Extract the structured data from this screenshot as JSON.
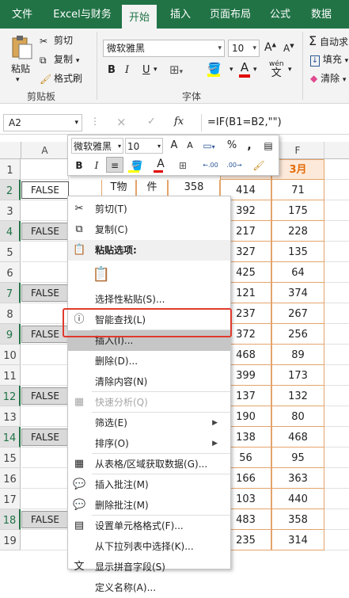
{
  "tabs": [
    "文件",
    "Excel与财务",
    "开始",
    "插入",
    "页面布局",
    "公式",
    "数据"
  ],
  "active_tab": "开始",
  "ribbon": {
    "paste_label": "粘贴",
    "cut_label": "剪切",
    "copy_label": "复制",
    "format_painter_label": "格式刷",
    "clipboard_group": "剪贴板",
    "font_name": "微软雅黑",
    "font_size": "10",
    "font_group": "字体",
    "autosum_label": "自动求",
    "fill_label": "填充",
    "clear_label": "清除",
    "bold": "B",
    "italic": "I",
    "underline": "U",
    "phonetic": "wén",
    "grow_font": "A",
    "shrink_font": "A"
  },
  "formula_bar": {
    "name_box": "A2",
    "cancel": "×",
    "enter": "✓",
    "fx": "fx",
    "formula": "=IF(B1=B2,\"\")"
  },
  "columns": [
    "A",
    "F"
  ],
  "rows": [
    "1",
    "2",
    "3",
    "4",
    "5",
    "6",
    "7",
    "8",
    "9",
    "10",
    "11",
    "12",
    "13",
    "14",
    "15",
    "16",
    "17",
    "18",
    "19"
  ],
  "col_a_values": {
    "2": "FALSE",
    "4": "FALSE",
    "7": "FALSE",
    "9": "FALSE",
    "12": "FALSE",
    "14": "FALSE",
    "18": "FALSE"
  },
  "header_f": "3月",
  "col_e": [
    "414",
    "392",
    "217",
    "327",
    "425",
    "121",
    "237",
    "372",
    "468",
    "399",
    "137",
    "190",
    "138",
    "56",
    "166",
    "103",
    "483",
    "235"
  ],
  "col_f": [
    "71",
    "175",
    "228",
    "135",
    "64",
    "374",
    "267",
    "256",
    "89",
    "173",
    "132",
    "80",
    "468",
    "95",
    "363",
    "440",
    "358",
    "314"
  ],
  "partial_cells": {
    "b2": "T物",
    "c2": "件",
    "d2": "358"
  },
  "mini_toolbar": {
    "font_name": "微软雅黑",
    "font_size": "10",
    "grow": "A",
    "shrink": "A",
    "percent": "%",
    "comma": ",",
    "bold": "B",
    "italic": "I",
    "dec_inc": ".00",
    "dec_dec": ".00"
  },
  "menu": [
    {
      "label": "剪切(T)",
      "icon": "scissors-icon",
      "glyph": "✂",
      "state": "normal"
    },
    {
      "label": "复制(C)",
      "icon": "copy-icon",
      "glyph": "⧉",
      "state": "normal"
    },
    {
      "label": "粘贴选项:",
      "icon": "clipboard-icon",
      "glyph": "📋",
      "state": "header"
    },
    {
      "label": "",
      "icon": "paste-option-icon",
      "glyph": "📋",
      "state": "paste-option"
    },
    {
      "label": "选择性粘贴(S)...",
      "icon": "",
      "glyph": "",
      "state": "normal"
    },
    {
      "label": "智能查找(L)",
      "icon": "info-icon",
      "glyph": "ⓘ",
      "state": "normal"
    },
    {
      "label": "插入(I)...",
      "icon": "",
      "glyph": "",
      "state": "highlighted"
    },
    {
      "label": "删除(D)...",
      "icon": "",
      "glyph": "",
      "state": "normal"
    },
    {
      "label": "清除内容(N)",
      "icon": "",
      "glyph": "",
      "state": "normal"
    },
    {
      "label": "快速分析(Q)",
      "icon": "quick-analysis-icon",
      "glyph": "▦",
      "state": "disabled"
    },
    {
      "label": "筛选(E)",
      "icon": "",
      "glyph": "",
      "state": "submenu"
    },
    {
      "label": "排序(O)",
      "icon": "",
      "glyph": "",
      "state": "submenu"
    },
    {
      "label": "从表格/区域获取数据(G)...",
      "icon": "table-icon",
      "glyph": "▦",
      "state": "normal"
    },
    {
      "label": "插入批注(M)",
      "icon": "insert-comment-icon",
      "glyph": "💬",
      "state": "normal"
    },
    {
      "label": "删除批注(M)",
      "icon": "delete-comment-icon",
      "glyph": "💬",
      "state": "normal"
    },
    {
      "label": "设置单元格格式(F)...",
      "icon": "format-cells-icon",
      "glyph": "▤",
      "state": "normal"
    },
    {
      "label": "从下拉列表中选择(K)...",
      "icon": "",
      "glyph": "",
      "state": "normal"
    },
    {
      "label": "显示拼音字段(S)",
      "icon": "phonetic-icon",
      "glyph": "文",
      "state": "normal"
    },
    {
      "label": "定义名称(A)...",
      "icon": "",
      "glyph": "",
      "state": "normal"
    }
  ],
  "colors": {
    "accent": "#217346",
    "highlight_box": "#e03a2c",
    "cell_border": "#e4a46b",
    "header_f_color": "#e26b0a"
  }
}
